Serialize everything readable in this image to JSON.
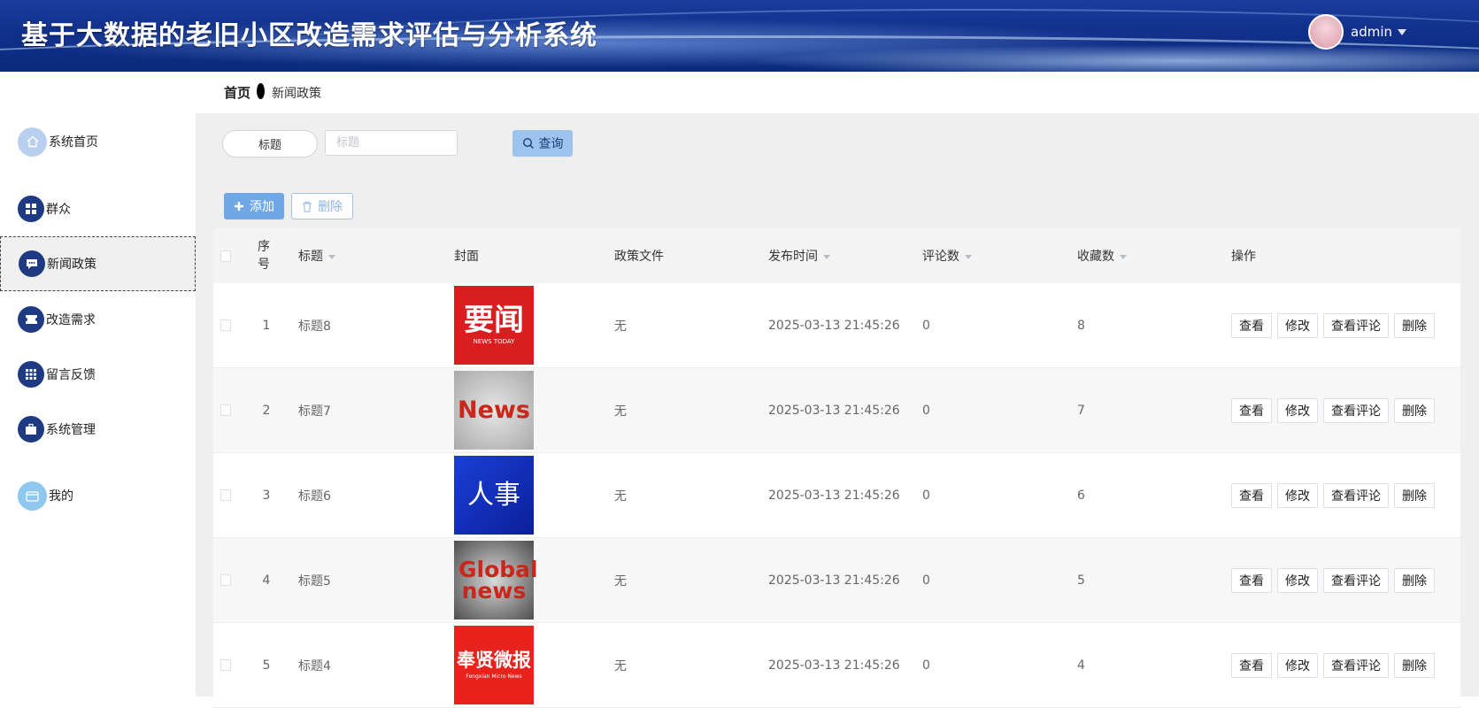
{
  "header": {
    "title": "基于大数据的老旧小区改造需求评估与分析系统",
    "username": "admin"
  },
  "sidebar": {
    "items": [
      {
        "label": "系统首页",
        "icon": "home-icon"
      },
      {
        "label": "群众",
        "icon": "grid-icon"
      },
      {
        "label": "新闻政策",
        "icon": "chat-icon"
      },
      {
        "label": "改造需求",
        "icon": "ticket-icon"
      },
      {
        "label": "留言反馈",
        "icon": "apps-icon"
      },
      {
        "label": "系统管理",
        "icon": "briefcase-icon"
      },
      {
        "label": "我的",
        "icon": "wallet-icon"
      }
    ],
    "active_index": 2
  },
  "breadcrumb": {
    "home": "首页",
    "current": "新闻政策"
  },
  "search": {
    "field_label": "标题",
    "placeholder": "标题",
    "query_label": "查询"
  },
  "toolbar": {
    "add_label": "添加",
    "delete_label": "删除"
  },
  "table": {
    "columns": {
      "no": "序号",
      "title": "标题",
      "cover": "封面",
      "file": "政策文件",
      "time": "发布时间",
      "comments": "评论数",
      "favorites": "收藏数",
      "ops": "操作"
    },
    "rows": [
      {
        "no": "1",
        "title": "标题8",
        "cover_text": "要闻",
        "cover_sub": "NEWS TODAY",
        "file": "无",
        "time": "2025-03-13 21:45:26",
        "comments": "0",
        "favorites": "8"
      },
      {
        "no": "2",
        "title": "标题7",
        "cover_text": "News",
        "cover_sub": "",
        "file": "无",
        "time": "2025-03-13 21:45:26",
        "comments": "0",
        "favorites": "7"
      },
      {
        "no": "3",
        "title": "标题6",
        "cover_text": "人事",
        "cover_sub": "",
        "file": "无",
        "time": "2025-03-13 21:45:26",
        "comments": "0",
        "favorites": "6"
      },
      {
        "no": "4",
        "title": "标题5",
        "cover_text": "Global news",
        "cover_sub": "",
        "file": "无",
        "time": "2025-03-13 21:45:26",
        "comments": "0",
        "favorites": "5"
      },
      {
        "no": "5",
        "title": "标题4",
        "cover_text": "奉贤微报",
        "cover_sub": "Fengxian Micro News",
        "file": "无",
        "time": "2025-03-13 21:45:26",
        "comments": "0",
        "favorites": "4"
      }
    ],
    "row_actions": {
      "view": "查看",
      "edit": "修改",
      "comments": "查看评论",
      "delete": "删除"
    }
  },
  "colors": {
    "header_bg": "#10308a",
    "nav_icon": "#1e3a82",
    "primary": "#6fa8e6"
  }
}
